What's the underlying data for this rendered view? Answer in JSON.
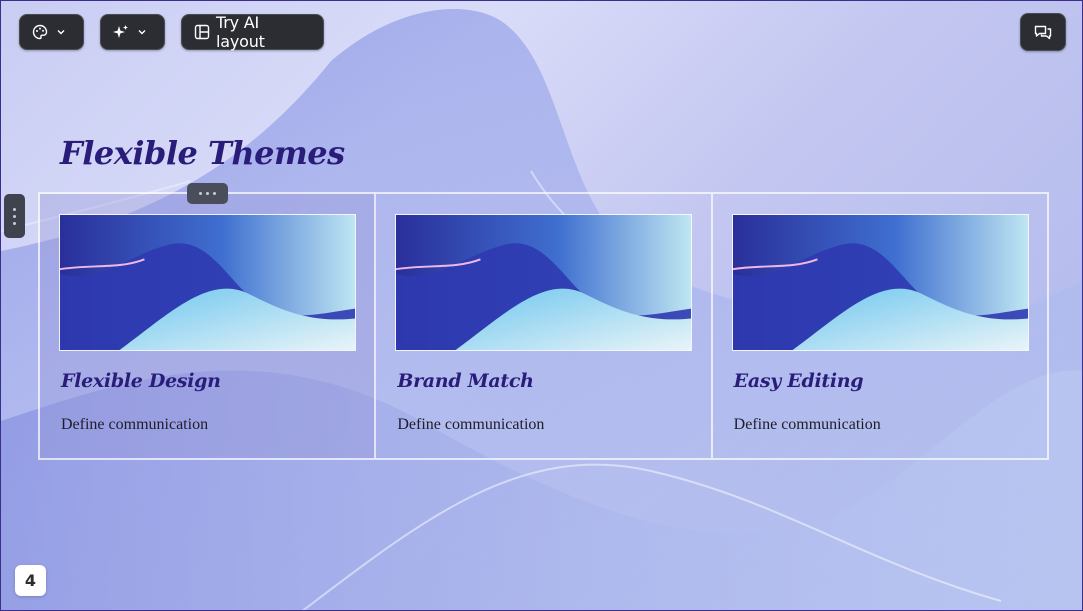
{
  "toolbar": {
    "theme_icon": "palette-icon",
    "ai_icon": "sparkle-icon",
    "layout_icon": "layout-icon",
    "layout_label": "Try AI layout",
    "comment_icon": "comment-icon"
  },
  "slide": {
    "title": "Flexible Themes",
    "page_number": "4",
    "cards": [
      {
        "heading": "Flexible Design",
        "description": "Define communication"
      },
      {
        "heading": "Brand Match",
        "description": "Define communication"
      },
      {
        "heading": "Easy Editing",
        "description": "Define communication"
      }
    ]
  },
  "colors": {
    "title": "#2a1d7a",
    "toolbar_bg": "#2b2d33"
  }
}
